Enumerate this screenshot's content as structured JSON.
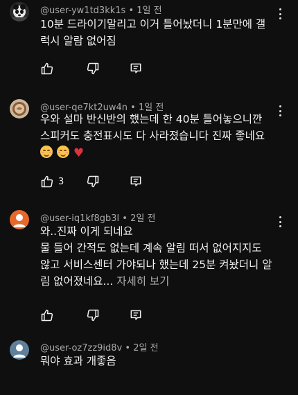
{
  "comments": [
    {
      "username": "@user-yw1td3kk1s",
      "time": "1일 전",
      "lines": [
        "10분 드라이기말리고 이거 틀어놨더니 1분만에 갤",
        "럭시 알람 없어짐"
      ],
      "like_count": ""
    },
    {
      "username": "@user-qe7kt2uw4n",
      "time": "1일 전",
      "lines": [
        "우와 설마 반신반의 했는데 한 40분 틀어놓으니깐",
        "스피커도 충전표시도 다 사라졌습니다 진짜 좋네요"
      ],
      "emoji_line": [
        "smiling-face-emoji",
        "smiling-face-emoji",
        "red-heart-emoji"
      ],
      "like_count": "3"
    },
    {
      "username": "@user-iq1kf8gb3l",
      "time": "2일 전",
      "lines": [
        "와..진짜 이게 되네요",
        "물 들어 간적도 없는데 계속 알림 떠서 없어지지도",
        "않고 서비스센터 가야되나 했는데 25분 켜놨더니 알"
      ],
      "last_line": "림 없어졌네요...",
      "read_more": "자세히 보기",
      "like_count": ""
    },
    {
      "username": "@user-oz7zz9id8v",
      "time": "2일 전",
      "lines": [
        "뭐야 효과 개좋음"
      ],
      "like_count": ""
    }
  ],
  "separator": "•",
  "icons": {
    "like": "thumbs-up-icon",
    "dislike": "thumbs-down-icon",
    "reply": "reply-icon",
    "more": "more-vertical-icon"
  },
  "colors": {
    "background": "#0f0f0f",
    "text": "#f1f1f1",
    "secondary": "#aaaaaa",
    "avatar_default": "#5f7f9a",
    "avatar_orange": "#e8682b"
  }
}
